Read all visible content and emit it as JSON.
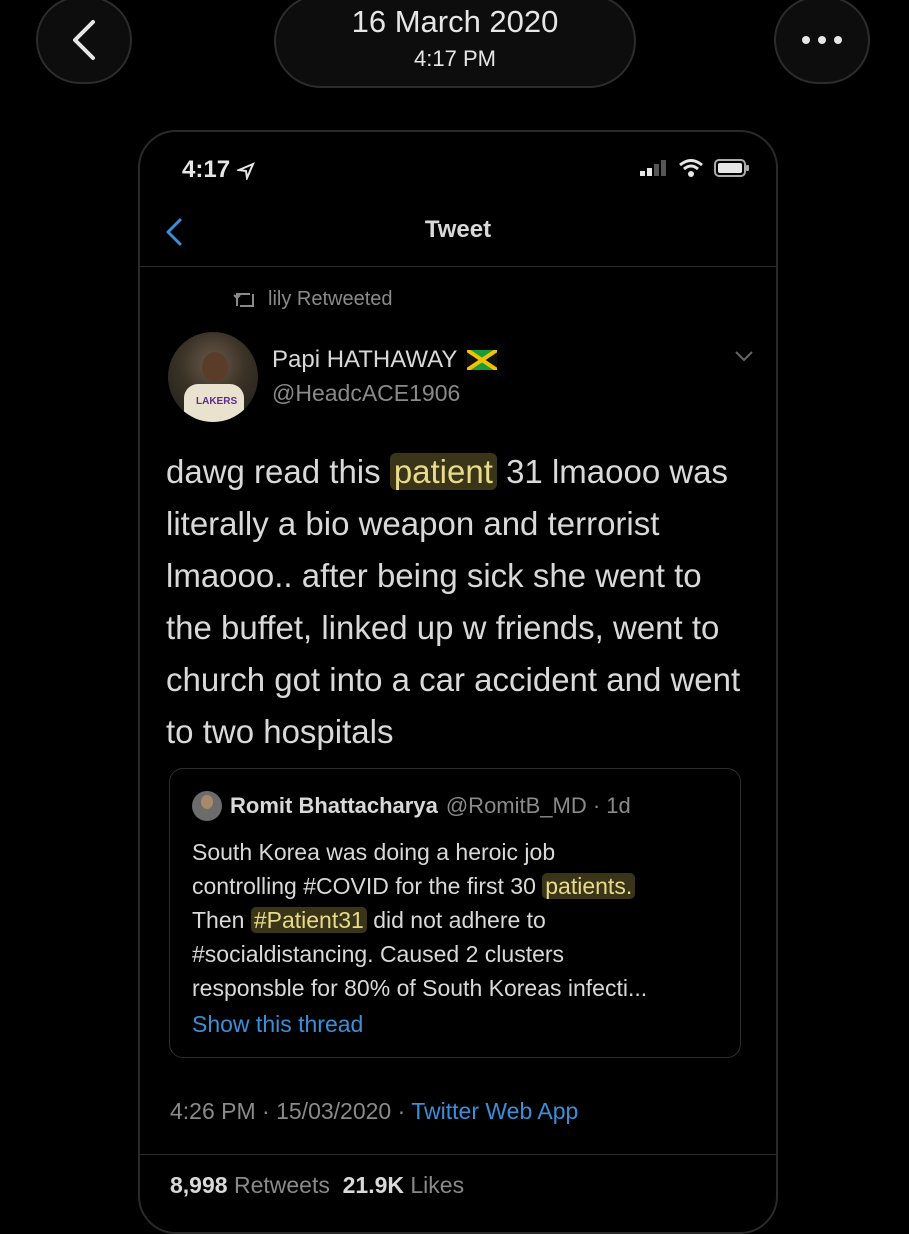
{
  "viewer": {
    "date": "16 March 2020",
    "time": "4:17 PM"
  },
  "phone": {
    "status_time": "4:17",
    "nav_title": "Tweet",
    "retweeted_by": "lily Retweeted",
    "author": {
      "name": "Papi HATHAWAY",
      "handle": "@HeadcACE1906"
    },
    "tweet": {
      "text_before": "dawg read this",
      "highlight": "patient",
      "text_after": "31 lmaooo was literally a bio weapon and terrorist lmaooo.. after being sick she went to the buffet, linked up w friends, went to church got into a car accident and went to two hospitals"
    },
    "quote": {
      "name": "Romit Bhattacharya",
      "handle_time": "@RomitB_MD · 1d",
      "line1": "South Korea was doing a heroic job",
      "line2_before": "controlling #COVID for the first 30",
      "line2_hl": "patients.",
      "line3_before": "Then",
      "line3_hl": "#Patient31",
      "line3_after": "did not adhere to",
      "line4": "#socialdistancing. Caused 2 clusters",
      "line5": "responsble for 80% of South Koreas infecti...",
      "show_thread": "Show this thread"
    },
    "meta": {
      "timestamp": "4:26 PM · 15/03/2020 ·",
      "source": "Twitter Web App"
    },
    "stats": {
      "retweets_count": "8,998",
      "retweets_label": "Retweets",
      "likes_count": "21.9K",
      "likes_label": "Likes"
    }
  },
  "colors": {
    "background": "#000000",
    "highlight_bg": "#3a3418",
    "highlight_text": "#e8dc8a",
    "link": "#3a8fd9"
  }
}
